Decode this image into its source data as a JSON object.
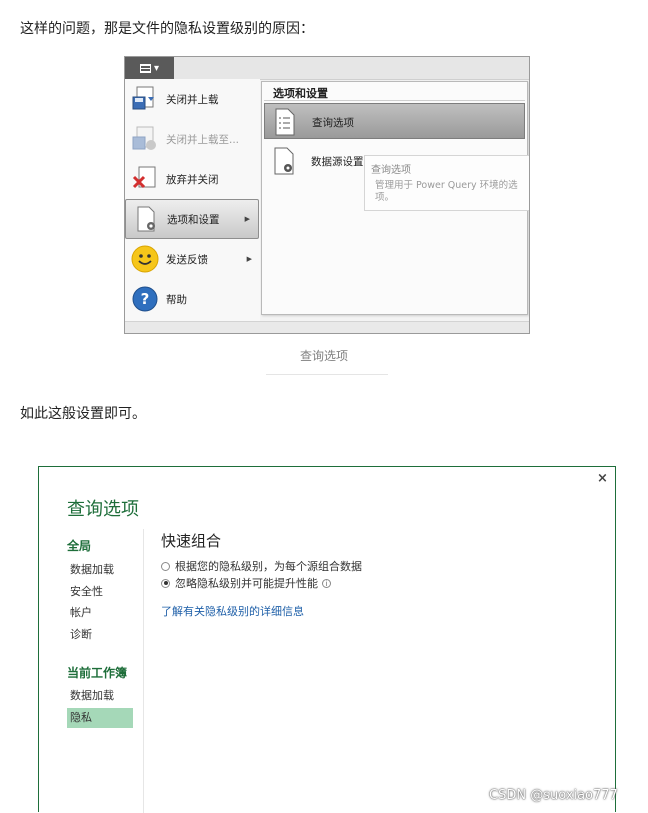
{
  "article": {
    "para1": "这样的问题，那是文件的隐私设置级别的原因：",
    "caption1": "查询选项",
    "para2": "如此这般设置即可。"
  },
  "excel_menu": {
    "items": [
      {
        "label": "关闭并上载",
        "icon": "close-and-load-icon",
        "state": "normal"
      },
      {
        "label": "关闭并上载至...",
        "icon": "close-and-load-to-icon",
        "state": "disabled"
      },
      {
        "label": "放弃并关闭",
        "icon": "discard-and-close-icon",
        "state": "normal"
      },
      {
        "label": "选项和设置",
        "icon": "options-settings-icon",
        "state": "selected",
        "has_submenu": true
      },
      {
        "label": "发送反馈",
        "icon": "smiley-icon",
        "state": "normal",
        "has_submenu": true
      },
      {
        "label": "帮助",
        "icon": "help-icon",
        "state": "normal"
      }
    ],
    "submenu": {
      "title": "选项和设置",
      "items": [
        {
          "label": "查询选项",
          "icon": "query-options-icon",
          "state": "selected"
        },
        {
          "label": "数据源设置",
          "icon": "data-source-settings-icon",
          "state": "normal"
        }
      ]
    },
    "tooltip": {
      "title": "查询选项",
      "body": "管理用于 Power Query 环境的选项。"
    }
  },
  "dialog": {
    "title": "查询选项",
    "close_symbol": "×",
    "nav": {
      "global_heading": "全局",
      "global_items": [
        "数据加载",
        "安全性",
        "帐户",
        "诊断"
      ],
      "workbook_heading": "当前工作簿",
      "workbook_items": [
        "数据加载",
        "隐私"
      ],
      "active_item": "隐私"
    },
    "section_title": "快速组合",
    "options": [
      {
        "label": "根据您的隐私级别，为每个源组合数据",
        "selected": false
      },
      {
        "label": "忽略隐私级别并可能提升性能",
        "selected": true,
        "info_icon": true
      }
    ],
    "info_symbol": "i",
    "learn_more": "了解有关隐私级别的详细信息"
  },
  "watermark": "CSDN @suoxiao777",
  "colors": {
    "dialog_accent": "#1e6e3a",
    "nav_active_bg": "#a5d8b8",
    "link": "#1e5fa8"
  }
}
